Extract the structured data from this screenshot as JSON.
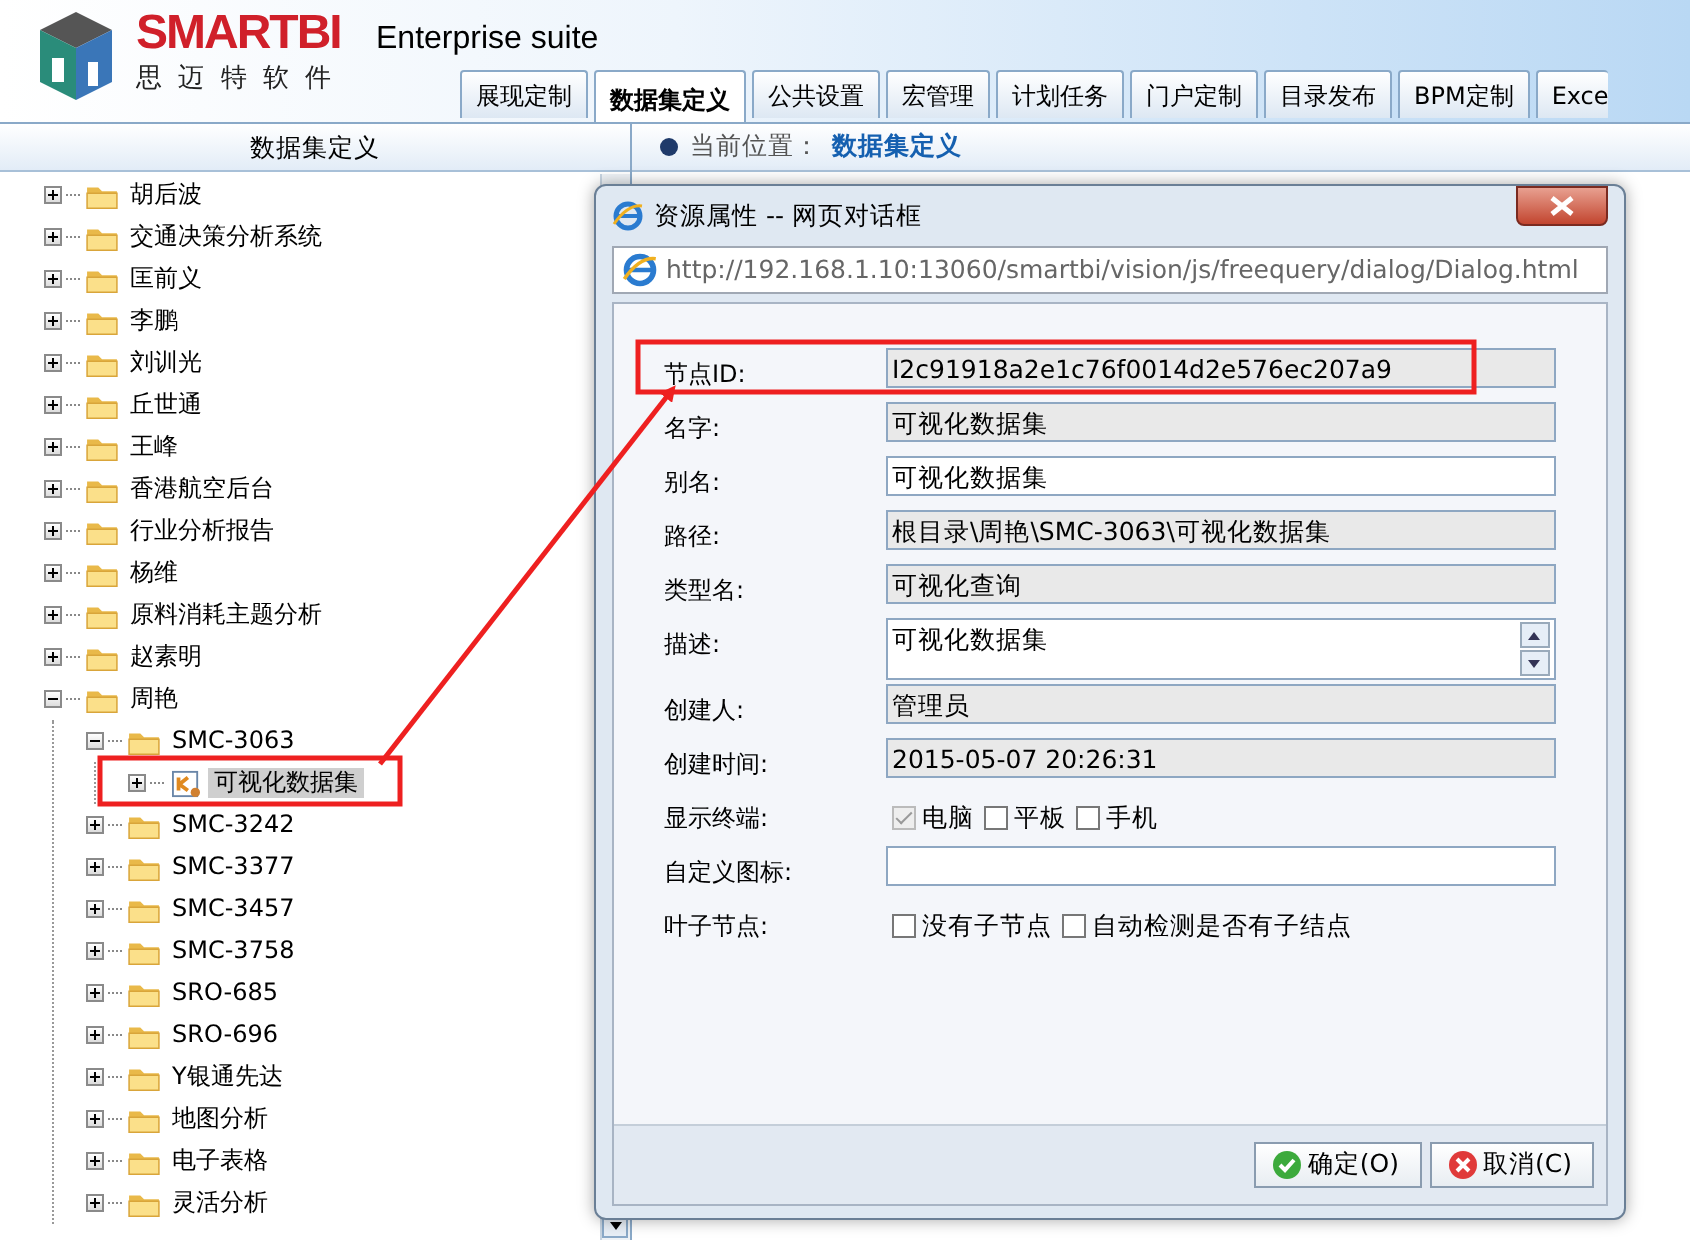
{
  "header": {
    "logo": "SMARTBI",
    "logo_subtitle": "思 迈 特 软 件",
    "product": "Enterprise suite"
  },
  "tabs": [
    {
      "label": "展现定制",
      "selected": false
    },
    {
      "label": "数据集定义",
      "selected": true
    },
    {
      "label": "公共设置",
      "selected": false
    },
    {
      "label": "宏管理",
      "selected": false
    },
    {
      "label": "计划任务",
      "selected": false
    },
    {
      "label": "门户定制",
      "selected": false
    },
    {
      "label": "目录发布",
      "selected": false
    },
    {
      "label": "BPM定制",
      "selected": false
    },
    {
      "label": "Exce",
      "selected": false
    }
  ],
  "sidebar": {
    "title": "数据集定义",
    "tree": [
      {
        "label": "胡后波",
        "kind": "folder",
        "expanded": false,
        "selected": false
      },
      {
        "label": "交通决策分析系统",
        "kind": "folder",
        "expanded": false,
        "selected": false
      },
      {
        "label": "匡前义",
        "kind": "folder",
        "expanded": false,
        "selected": false
      },
      {
        "label": "李鹏",
        "kind": "folder",
        "expanded": false,
        "selected": false
      },
      {
        "label": "刘训光",
        "kind": "folder",
        "expanded": false,
        "selected": false
      },
      {
        "label": "丘世通",
        "kind": "folder",
        "expanded": false,
        "selected": false
      },
      {
        "label": "王峰",
        "kind": "folder",
        "expanded": false,
        "selected": false
      },
      {
        "label": "香港航空后台",
        "kind": "folder",
        "expanded": false,
        "selected": false
      },
      {
        "label": "行业分析报告",
        "kind": "folder",
        "expanded": false,
        "selected": false
      },
      {
        "label": "杨维",
        "kind": "folder",
        "expanded": false,
        "selected": false
      },
      {
        "label": "原料消耗主题分析",
        "kind": "folder",
        "expanded": false,
        "selected": false
      },
      {
        "label": "赵素明",
        "kind": "folder",
        "expanded": false,
        "selected": false
      },
      {
        "label": "周艳",
        "kind": "folder",
        "expanded": true,
        "selected": false,
        "children": [
          {
            "label": "SMC-3063",
            "kind": "folder",
            "expanded": true,
            "selected": false,
            "children": [
              {
                "label": "可视化数据集",
                "kind": "dataset",
                "expanded": false,
                "selected": true
              }
            ]
          },
          {
            "label": "SMC-3242",
            "kind": "folder",
            "expanded": false,
            "selected": false
          },
          {
            "label": "SMC-3377",
            "kind": "folder",
            "expanded": false,
            "selected": false
          },
          {
            "label": "SMC-3457",
            "kind": "folder",
            "expanded": false,
            "selected": false
          },
          {
            "label": "SMC-3758",
            "kind": "folder",
            "expanded": false,
            "selected": false
          },
          {
            "label": "SRO-685",
            "kind": "folder",
            "expanded": false,
            "selected": false
          },
          {
            "label": "SRO-696",
            "kind": "folder",
            "expanded": false,
            "selected": false
          },
          {
            "label": "Y银通先达",
            "kind": "folder",
            "expanded": false,
            "selected": false
          },
          {
            "label": "地图分析",
            "kind": "folder",
            "expanded": false,
            "selected": false
          },
          {
            "label": "电子表格",
            "kind": "folder",
            "expanded": false,
            "selected": false
          },
          {
            "label": "灵活分析",
            "kind": "folder",
            "expanded": false,
            "selected": false
          }
        ]
      }
    ]
  },
  "breadcrumb": {
    "label": "当前位置：",
    "current": "数据集定义"
  },
  "dialog": {
    "title": "资源属性 -- 网页对话框",
    "url": "http://192.168.1.10:13060/smartbi/vision/js/freequery/dialog/Dialog.html",
    "fields": [
      {
        "label": "节点ID:",
        "kind": "readonly",
        "value": "I2c91918a2e1c76f0014d2e576ec207a9"
      },
      {
        "label": "名字:",
        "kind": "readonly",
        "value": "可视化数据集"
      },
      {
        "label": "别名:",
        "kind": "input",
        "value": "可视化数据集"
      },
      {
        "label": "路径:",
        "kind": "readonly",
        "value": "根目录\\周艳\\SMC-3063\\可视化数据集"
      },
      {
        "label": "类型名:",
        "kind": "readonly",
        "value": "可视化查询"
      },
      {
        "label": "描述:",
        "kind": "textarea",
        "value": "可视化数据集"
      },
      {
        "label": "创建人:",
        "kind": "readonly",
        "value": "管理员"
      },
      {
        "label": "创建时间:",
        "kind": "readonly",
        "value": "2015-05-07 20:26:31"
      },
      {
        "label": "显示终端:",
        "kind": "checks",
        "options": [
          {
            "label": "电脑",
            "checked": true,
            "disabled": true
          },
          {
            "label": "平板",
            "checked": false,
            "disabled": false
          },
          {
            "label": "手机",
            "checked": false,
            "disabled": false
          }
        ]
      },
      {
        "label": "自定义图标:",
        "kind": "input"
      },
      {
        "label": "叶子节点:",
        "kind": "checks",
        "options": [
          {
            "label": "没有子节点",
            "checked": false,
            "disabled": false
          },
          {
            "label": "自动检测是否有子结点",
            "checked": false,
            "disabled": false
          }
        ]
      }
    ],
    "buttons": [
      {
        "label": "确定(O)",
        "kind": "ok"
      },
      {
        "label": "取消(C)",
        "kind": "cancel"
      }
    ]
  }
}
